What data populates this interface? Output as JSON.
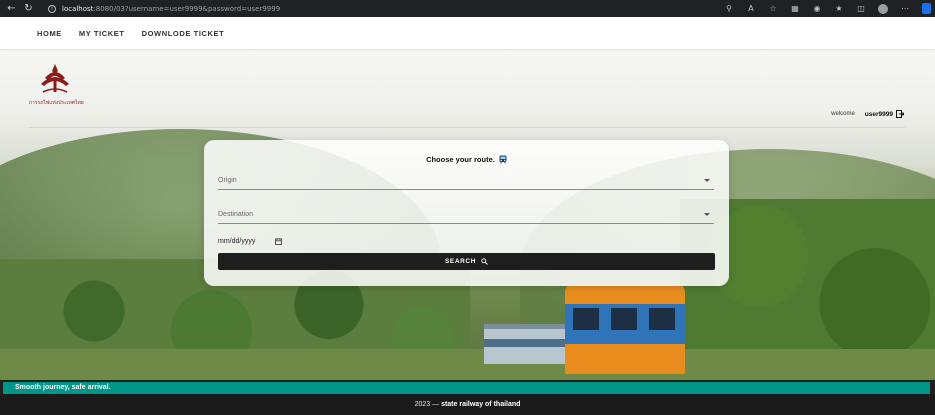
{
  "browser": {
    "url_host": "localhost",
    "url_path": ":8080/03?username=user9999&password=user9999"
  },
  "nav": {
    "items": [
      "HOME",
      "MY TICKET",
      "DOWNLODE TICKET"
    ]
  },
  "brand": {
    "logo_text": "การรถไฟแห่งประเทศไทย",
    "accent_color": "#8b1c1c"
  },
  "user": {
    "welcome_label": "welcome",
    "username": "user9999"
  },
  "search_card": {
    "title": "Choose your route.",
    "origin_placeholder": "Origin",
    "destination_placeholder": "Destination",
    "date_placeholder": "mm/dd/yyyy",
    "search_label": "SEARCH"
  },
  "banner": {
    "text": "Smooth journey, safe arrival.",
    "color": "#009688"
  },
  "footer": {
    "year_text": "2023 —",
    "org_text": "state railway of thailand"
  }
}
